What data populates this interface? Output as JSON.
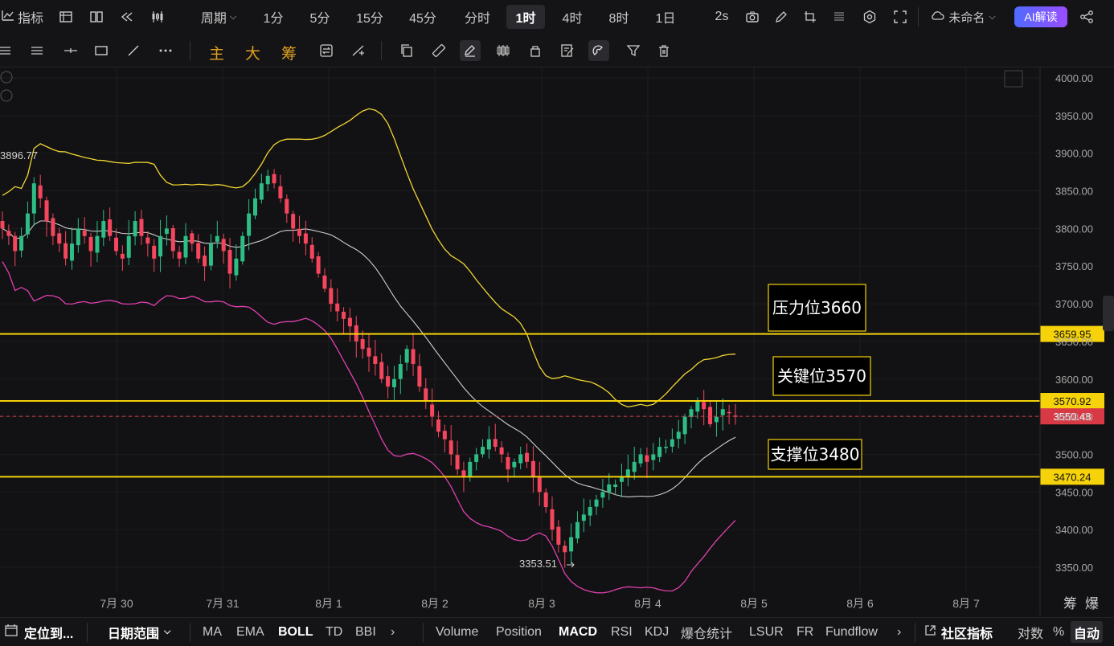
{
  "topbar": {
    "indicators_label": "指标",
    "period_label": "周期",
    "intervals": [
      "1分",
      "5分",
      "15分",
      "45分",
      "分时",
      "1时",
      "4时",
      "8时",
      "1日"
    ],
    "selected_interval": "1时",
    "refresh_label": "2s",
    "layout_name": "未命名",
    "ai_label": "AI解读"
  },
  "drawbar": {
    "main_label": "主",
    "big_label": "大",
    "chip_label": "筹"
  },
  "chart": {
    "y_ticks": [
      "4000.00",
      "3950.00",
      "3900.00",
      "3850.00",
      "3800.00",
      "3750.00",
      "3700.00",
      "3650.00",
      "3600.00",
      "3550.00",
      "3500.00",
      "3450.00",
      "3400.00",
      "3350.00"
    ],
    "x_ticks": [
      "7月 30",
      "7月 31",
      "8月 1",
      "8月 2",
      "8月 3",
      "8月 4",
      "8月 5",
      "8月 6",
      "8月 7"
    ],
    "price_labels": {
      "resistance": "3659.95",
      "key": "3570.92",
      "last": "3550.48",
      "support": "3470.24"
    },
    "high_marker": "3896.77",
    "low_marker": "3353.51",
    "annotations": {
      "resistance": "压力位3660",
      "key": "关键位3570",
      "support": "支撑位3480"
    },
    "corner_labels": [
      "筹",
      "爆"
    ],
    "colors": {
      "up": "#2ebd85",
      "down": "#f6465d",
      "level": "#f5d20a",
      "boll_upper": "#f2d632",
      "boll_mid": "#cfcfcf",
      "boll_lower": "#e040b0",
      "last_price": "#d83a45"
    }
  },
  "chart_data": {
    "type": "candlestick",
    "y_range": [
      3325,
      4015
    ],
    "x_categories": [
      "7月 30",
      "7月 31",
      "8月 1",
      "8月 2",
      "8月 3",
      "8月 4",
      "8月 5",
      "8月 6",
      "8月 7"
    ],
    "horizontal_levels": [
      3659.95,
      3570.92,
      3470.24
    ],
    "last_price": 3550.48,
    "marked_high": 3896.77,
    "marked_low": 3353.51,
    "closes_approx": [
      3800,
      3790,
      3770,
      3790,
      3820,
      3860,
      3840,
      3810,
      3790,
      3780,
      3760,
      3780,
      3800,
      3790,
      3770,
      3790,
      3810,
      3790,
      3770,
      3760,
      3790,
      3810,
      3790,
      3780,
      3760,
      3790,
      3800,
      3770,
      3760,
      3790,
      3780,
      3760,
      3750,
      3780,
      3790,
      3770,
      3740,
      3760,
      3790,
      3820,
      3840,
      3860,
      3870,
      3860,
      3840,
      3820,
      3800,
      3790,
      3780,
      3760,
      3740,
      3720,
      3700,
      3690,
      3680,
      3670,
      3650,
      3640,
      3630,
      3620,
      3600,
      3590,
      3600,
      3620,
      3640,
      3620,
      3590,
      3570,
      3550,
      3530,
      3520,
      3500,
      3480,
      3470,
      3490,
      3500,
      3510,
      3520,
      3510,
      3500,
      3480,
      3490,
      3500,
      3490,
      3470,
      3450,
      3430,
      3400,
      3380,
      3370,
      3390,
      3410,
      3420,
      3430,
      3440,
      3450,
      3460,
      3460,
      3470,
      3480,
      3490,
      3500,
      3490,
      3500,
      3510,
      3510,
      3520,
      3530,
      3550,
      3560,
      3570,
      3560,
      3540,
      3550,
      3560,
      3555,
      3550
    ]
  },
  "bottombar": {
    "locate_label": "定位到...",
    "date_range_label": "日期范围",
    "main_indicators": [
      "MA",
      "EMA",
      "BOLL",
      "TD",
      "BBI"
    ],
    "active_main": "BOLL",
    "sub_indicators": [
      "Volume",
      "Position",
      "MACD",
      "RSI",
      "KDJ",
      "爆仓统计",
      "LSUR",
      "FR",
      "Fundflow"
    ],
    "active_sub": "MACD",
    "community_label": "社区指标",
    "log_label": "对数",
    "percent_label": "%",
    "auto_label": "自动"
  }
}
